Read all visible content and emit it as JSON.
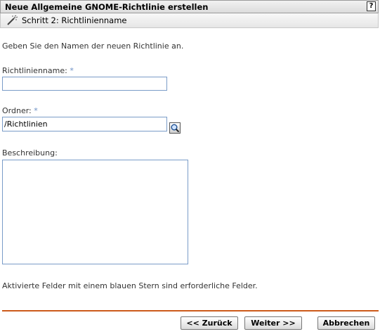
{
  "header": {
    "title": "Neue Allgemeine GNOME-Richtlinie erstellen",
    "help_label": "?",
    "step_title": "Schritt 2: Richtlinienname",
    "step_icon": "wizard-wand-icon"
  },
  "form": {
    "instructions": "Geben Sie den Namen der neuen Richtlinie an.",
    "required_marker": "*",
    "name": {
      "label": "Richtlinienname:",
      "value": ""
    },
    "folder": {
      "label": "Ordner:",
      "value": "/Richtlinien",
      "browse_icon": "magnifier-icon"
    },
    "description": {
      "label": "Beschreibung:",
      "value": ""
    },
    "footnote": "Aktivierte Felder mit einem blauen Stern sind erforderliche Felder."
  },
  "buttons": {
    "back": "<< Zurück",
    "next": "Weiter >>",
    "cancel": "Abbrechen"
  },
  "colors": {
    "required_star": "#6b8fc5",
    "field_border": "#7a9cc8",
    "divider": "#cc5a1a"
  }
}
